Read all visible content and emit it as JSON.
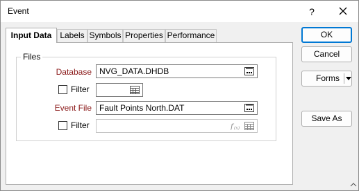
{
  "window": {
    "title": "Event",
    "help_label": "?"
  },
  "tabs": [
    {
      "label": "Input Data",
      "active": true
    },
    {
      "label": "Labels",
      "active": false
    },
    {
      "label": "Symbols",
      "active": false
    },
    {
      "label": "Properties",
      "active": false
    },
    {
      "label": "Performance",
      "active": false
    }
  ],
  "files_group": {
    "title": "Files",
    "database_label": "Database",
    "database_value": "NVG_DATA.DHDB",
    "filter1_label": "Filter",
    "filter1_checked": false,
    "filter1_value": "",
    "event_file_label": "Event File",
    "event_file_value": "Fault Points North.DAT",
    "filter2_label": "Filter",
    "filter2_checked": false,
    "filter2_value": ""
  },
  "buttons": {
    "ok": "OK",
    "cancel": "Cancel",
    "forms": "Forms",
    "save_as": "Save As"
  },
  "icons": [
    "close-icon",
    "ellipsis-browse-icon",
    "list-picker-icon",
    "function-fx-icon",
    "dropdown-arrow-icon",
    "resize-grip-icon"
  ],
  "colors": {
    "accent": "#0078d4",
    "required_label": "#8b1a1a"
  }
}
